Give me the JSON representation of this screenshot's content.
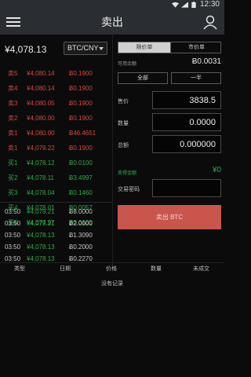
{
  "status_bar": {
    "time": "12:30",
    "icons": [
      "wifi-icon",
      "signal-icon",
      "battery-icon"
    ]
  },
  "app_bar": {
    "title": "卖出",
    "left_icon": "menu-icon",
    "right_icon": "user-icon"
  },
  "market": {
    "last_price": "¥4,078.13",
    "pair": "BTC/CNY"
  },
  "order_book": {
    "asks": [
      {
        "label": "卖5",
        "price": "¥4,080.14",
        "amount": "Ƀ0.1900"
      },
      {
        "label": "卖4",
        "price": "¥4,080.14",
        "amount": "Ƀ0.1900"
      },
      {
        "label": "卖3",
        "price": "¥4,080.05",
        "amount": "Ƀ0.1900"
      },
      {
        "label": "卖2",
        "price": "¥4,080.00",
        "amount": "Ƀ0.1900"
      },
      {
        "label": "卖1",
        "price": "¥4,080.00",
        "amount": "Ƀ46.4651"
      },
      {
        "label": "卖1",
        "price": "¥4,079.22",
        "amount": "Ƀ0.1900"
      }
    ],
    "bids": [
      {
        "label": "买1",
        "price": "¥4,078.12",
        "amount": "Ƀ0.0100"
      },
      {
        "label": "买2",
        "price": "¥4,078.11",
        "amount": "Ƀ3.4997"
      },
      {
        "label": "买3",
        "price": "¥4,078.04",
        "amount": "Ƀ0.1460"
      },
      {
        "label": "买4",
        "price": "¥4,078.01",
        "amount": "Ƀ0.0057"
      },
      {
        "label": "买5",
        "price": "¥4,077.97",
        "amount": "Ƀ0.0100"
      }
    ]
  },
  "recent_trades": [
    {
      "time": "03:50",
      "price": "¥4,079.21",
      "amount": "Ƀ8.0000"
    },
    {
      "time": "03:50",
      "price": "¥4,079.21",
      "amount": "Ƀ2.0000"
    },
    {
      "time": "03:50",
      "price": "¥4,078.13",
      "amount": "Ƀ1.3090"
    },
    {
      "time": "03:50",
      "price": "¥4,078.13",
      "amount": "Ƀ0.2000"
    },
    {
      "time": "03:50",
      "price": "¥4,078.13",
      "amount": "Ƀ0.2270"
    }
  ],
  "order_form": {
    "tabs": [
      "限价单",
      "市价单"
    ],
    "active_tab": 0,
    "balance_label": "可用余额",
    "balance_value": "Ƀ0.0031",
    "quick": [
      "全部",
      "一半"
    ],
    "price_label": "售价",
    "price_value": "3838.5",
    "qty_label": "数量",
    "qty_value": "0.0000",
    "total_label": "总额",
    "total_value": "0.000000",
    "estimate_label": "卖得金额",
    "estimate_value": "¥0",
    "password_label": "交易密码",
    "password_value": "",
    "submit": "卖出 BTC"
  },
  "history": {
    "columns": [
      "类型",
      "日期",
      "价格",
      "数量",
      "未成交"
    ],
    "empty_text": "没有记录"
  },
  "colors": {
    "sell": "#d5473f",
    "buy": "#2ea94a",
    "button": "#c8564d",
    "bar": "#2a2d31"
  }
}
